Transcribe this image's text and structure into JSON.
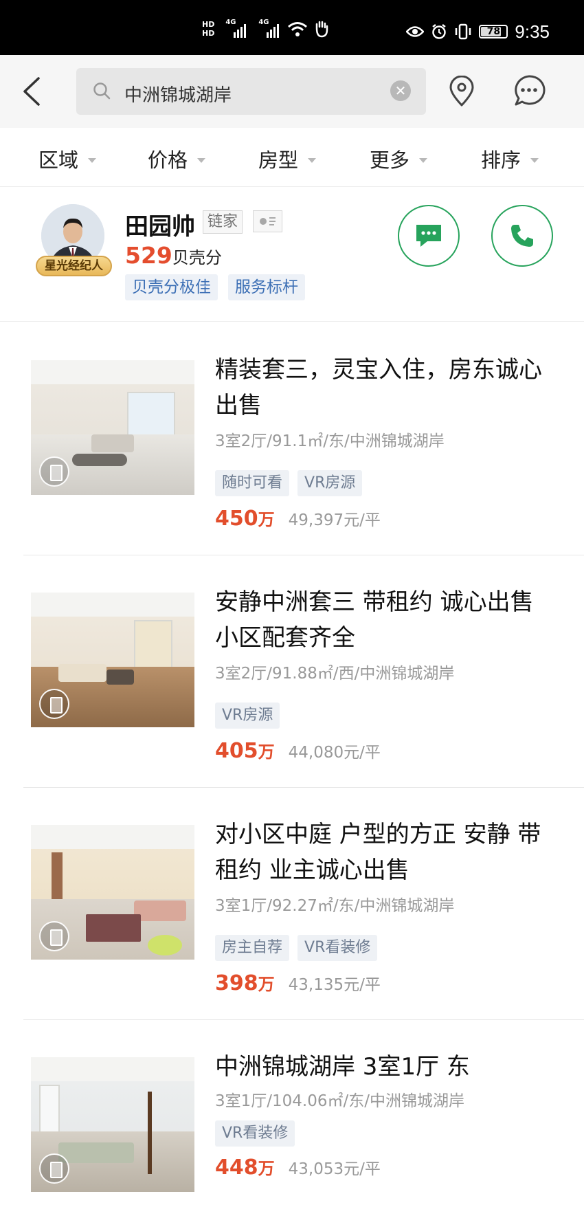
{
  "status_bar": {
    "hd1": "HD",
    "hd2": "HD",
    "net1": "4G",
    "net2": "4G",
    "battery": "78",
    "time": "9:35"
  },
  "search": {
    "query": "中洲锦城湖岸",
    "clear_icon": "clear-icon"
  },
  "filters": [
    {
      "label": "区域"
    },
    {
      "label": "价格"
    },
    {
      "label": "房型"
    },
    {
      "label": "更多"
    },
    {
      "label": "排序"
    }
  ],
  "agent": {
    "name": "田园帅",
    "company": "链家",
    "badge": "星光经纪人",
    "score": "529",
    "score_unit": "贝壳分",
    "tags": [
      "贝壳分极佳",
      "服务标杆"
    ],
    "accent": "#27a35c"
  },
  "listings": [
    {
      "title": "精装套三，灵宝入住，房东诚心出售",
      "specs": "3室2厅/91.1㎡/东/中洲锦城湖岸",
      "tags": [
        "随时可看",
        "VR房源"
      ],
      "price": "450",
      "price_unit": "万",
      "unit_price": "49,397元/平"
    },
    {
      "title": "安静中洲套三 带租约 诚心出售 小区配套齐全",
      "specs": "3室2厅/91.88㎡/西/中洲锦城湖岸",
      "tags": [
        "VR房源"
      ],
      "price": "405",
      "price_unit": "万",
      "unit_price": "44,080元/平"
    },
    {
      "title": "对小区中庭 户型的方正 安静 带租约 业主诚心出售",
      "specs": "3室1厅/92.27㎡/东/中洲锦城湖岸",
      "tags": [
        "房主自荐",
        "VR看装修"
      ],
      "price": "398",
      "price_unit": "万",
      "unit_price": "43,135元/平"
    },
    {
      "title": "中洲锦城湖岸 3室1厅 东",
      "specs": "3室1厅/104.06㎡/东/中洲锦城湖岸",
      "tags": [
        "VR看装修"
      ],
      "price": "448",
      "price_unit": "万",
      "unit_price": "43,053元/平"
    }
  ],
  "colors": {
    "price": "#e24e2c",
    "green": "#27a35c",
    "tag_blue": "#3c6fb5"
  }
}
